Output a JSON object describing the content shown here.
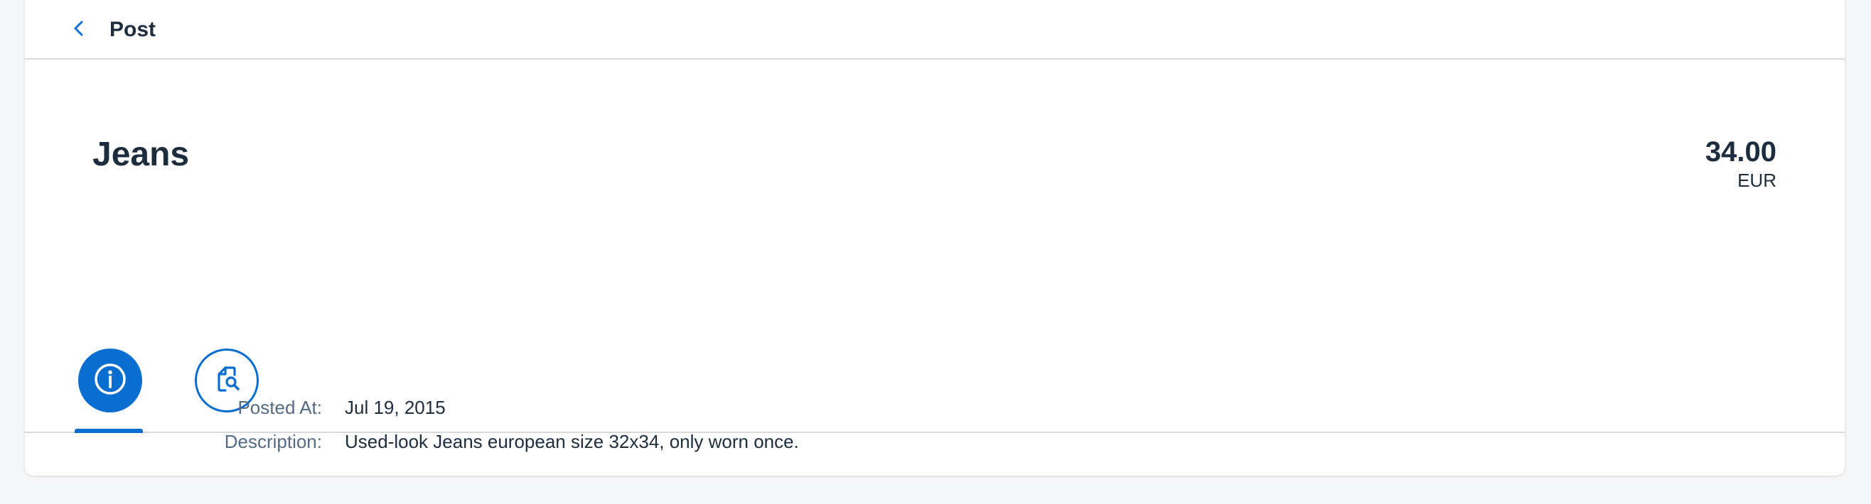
{
  "nav": {
    "back_icon": "chevron-left-icon",
    "title": "Post"
  },
  "object": {
    "title": "Jeans",
    "price": "34.00",
    "currency": "EUR"
  },
  "tabs": [
    {
      "icon": "information-icon",
      "selected": true
    },
    {
      "icon": "document-search-icon",
      "selected": false
    }
  ],
  "form": {
    "posted_at_label": "Posted At:",
    "posted_at_value": "Jul 19, 2015",
    "description_label": "Description:",
    "description_value": "Used-look Jeans european size 32x34, only worn once."
  },
  "colors": {
    "brand": "#0a6ed1",
    "text": "#1d2d3e",
    "label": "#556b82",
    "background": "#f5f6f7"
  }
}
